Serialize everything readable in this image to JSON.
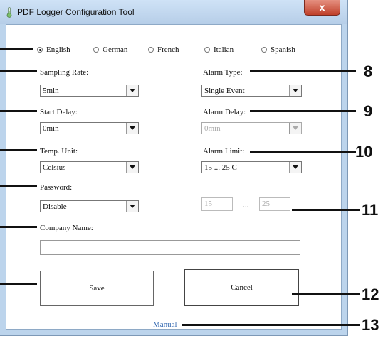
{
  "window": {
    "title": "PDF Logger Configuration Tool",
    "close_glyph": "x"
  },
  "languages": [
    {
      "label": "English",
      "selected": true
    },
    {
      "label": "German",
      "selected": false
    },
    {
      "label": "French",
      "selected": false
    },
    {
      "label": "Italian",
      "selected": false
    },
    {
      "label": "Spanish",
      "selected": false
    }
  ],
  "sampling_rate": {
    "label": "Sampling Rate:",
    "value": "5min"
  },
  "start_delay": {
    "label": "Start Delay:",
    "value": "0min"
  },
  "temp_unit": {
    "label": "Temp. Unit:",
    "value": "Celsius"
  },
  "password": {
    "label": "Password:",
    "value": "Disable"
  },
  "company": {
    "label": "Company Name:",
    "value": ""
  },
  "alarm_type": {
    "label": "Alarm Type:",
    "value": "Single Event"
  },
  "alarm_delay": {
    "label": "Alarm Delay:",
    "value": "0min"
  },
  "alarm_limit": {
    "label": "Alarm Limit:",
    "value": "15 ... 25  C",
    "low": "15",
    "separator": "...",
    "high": "25"
  },
  "buttons": {
    "save": "Save",
    "cancel": "Cancel"
  },
  "manual_link": "Manual",
  "callouts": [
    "8",
    "9",
    "10",
    "11",
    "12",
    "13"
  ]
}
